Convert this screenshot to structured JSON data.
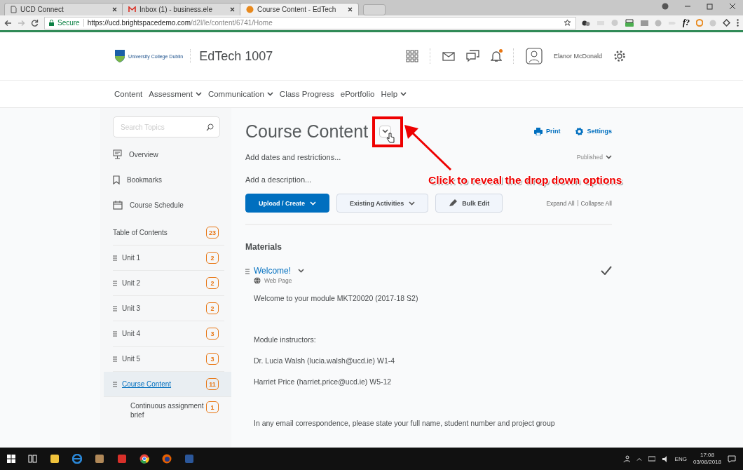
{
  "browser": {
    "tabs": [
      {
        "label": "UCD Connect",
        "kind": "page",
        "selected": false
      },
      {
        "label": "Inbox (1) - business.ele",
        "kind": "mail",
        "selected": false
      },
      {
        "label": "Course Content - EdTech",
        "kind": "site",
        "selected": true
      }
    ],
    "secure_label": "Secure",
    "url_host": "https://ucd.brightspacedemo.com",
    "url_path": "/d2l/le/content/6741/Home",
    "extension_label": "f?"
  },
  "header": {
    "logo_text": "University College Dublin",
    "course": "EdTech 1007",
    "user": "Elanor McDonald",
    "has_alert": true
  },
  "nav": [
    {
      "label": "Content",
      "has_menu": false
    },
    {
      "label": "Assessment",
      "has_menu": true
    },
    {
      "label": "Communication",
      "has_menu": true
    },
    {
      "label": "Class Progress",
      "has_menu": false
    },
    {
      "label": "ePortfolio",
      "has_menu": false
    },
    {
      "label": "Help",
      "has_menu": true
    }
  ],
  "sidebar": {
    "search_placeholder": "Search Topics",
    "links": [
      {
        "label": "Overview",
        "kind": "presentation"
      },
      {
        "label": "Bookmarks",
        "kind": "bookmark"
      },
      {
        "label": "Course Schedule",
        "kind": "calendar"
      }
    ],
    "toc": {
      "label": "Table of Contents",
      "count": "23"
    },
    "modules": [
      {
        "label": "Unit 1",
        "count": "2",
        "selected": false
      },
      {
        "label": "Unit 2",
        "count": "2",
        "selected": false
      },
      {
        "label": "Unit 3",
        "count": "2",
        "selected": false
      },
      {
        "label": "Unit 4",
        "count": "3",
        "selected": false
      },
      {
        "label": "Unit 5",
        "count": "3",
        "selected": false
      },
      {
        "label": "Course Content",
        "count": "11",
        "selected": true
      }
    ],
    "sub_item": {
      "label": "Continuous assignment brief",
      "count": "1"
    }
  },
  "main": {
    "title": "Course Content",
    "print": "Print",
    "settings": "Settings",
    "add_dates": "Add dates and restrictions...",
    "status": "Published",
    "add_description": "Add a description...",
    "buttons": [
      {
        "label": "Upload / Create",
        "kind": "primary"
      },
      {
        "label": "Existing Activities",
        "kind": "menu"
      },
      {
        "label": "Bulk Edit",
        "kind": "tool"
      }
    ],
    "expand_all": "Expand All",
    "collapse_all": "Collapse All",
    "section": "Materials",
    "item": {
      "title": "Welcome!",
      "type": "Web Page",
      "completed": true
    },
    "paragraph_groups": [
      [
        "Welcome to your module MKT20020 (2017-18 S2)"
      ],
      [
        "Module instructors:",
        "Dr. Lucia Walsh (lucia.walsh@ucd.ie) W1-4",
        "Harriet Price (harriet.price@ucd.ie) W5-12"
      ],
      [
        "In any email correspondence, please state your full name, student number and project group"
      ]
    ]
  },
  "annotation": {
    "text": "Click to reveal the drop down options"
  },
  "taskbar": {
    "language": "ENG",
    "time": "17:08",
    "date": "03/08/2018"
  }
}
